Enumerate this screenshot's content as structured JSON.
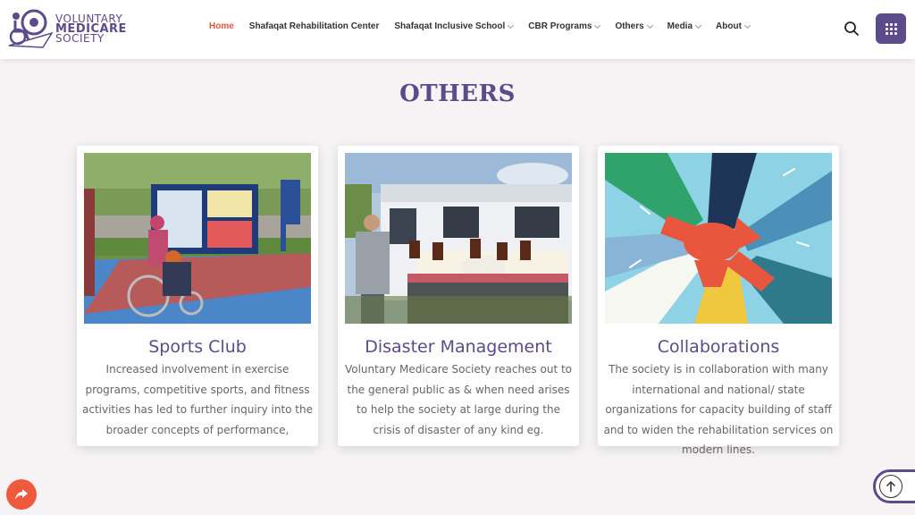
{
  "header": {
    "logo": {
      "line1": "VOLUNTARY",
      "line2": "MEDICARE",
      "line3": "SOCIETY"
    },
    "nav": [
      {
        "label": "Home",
        "active": true,
        "dropdown": false
      },
      {
        "label": "Shafaqat Rehabilitation Center",
        "active": false,
        "dropdown": false
      },
      {
        "label": "Shafaqat Inclusive School",
        "active": false,
        "dropdown": true
      },
      {
        "label": "CBR Programs",
        "active": false,
        "dropdown": true
      },
      {
        "label": "Others",
        "active": false,
        "dropdown": true
      },
      {
        "label": "Media",
        "active": false,
        "dropdown": true
      },
      {
        "label": "About",
        "active": false,
        "dropdown": true
      }
    ],
    "icons": {
      "search": "search-icon",
      "menu": "grid-menu-icon"
    }
  },
  "section": {
    "title": "OTHERS"
  },
  "cards": [
    {
      "title": "Sports Club",
      "image": "wheelchair-basketball-photo",
      "text": "Increased involvement in exercise programs, competitive sports, and fitness activities has led to further inquiry into the broader concepts of performance,"
    },
    {
      "title": "Disaster Management",
      "image": "relief-van-photo",
      "text": "Voluntary Medicare Society reaches out to the general public as & when need arises to help the society at large during the crisis of disaster of any kind eg."
    },
    {
      "title": "Collaborations",
      "image": "joined-hands-illustration",
      "text": "The society is in collaboration with many international and national/ state organizations for capacity building of staff and to widen the rehabilitation services on modern lines."
    }
  ],
  "floating": {
    "share": "share-icon",
    "scroll_top": "arrow-up-icon"
  },
  "colors": {
    "brand": "#5b4b8a",
    "accent": "#e5533d",
    "share": "#ef5a3c"
  }
}
